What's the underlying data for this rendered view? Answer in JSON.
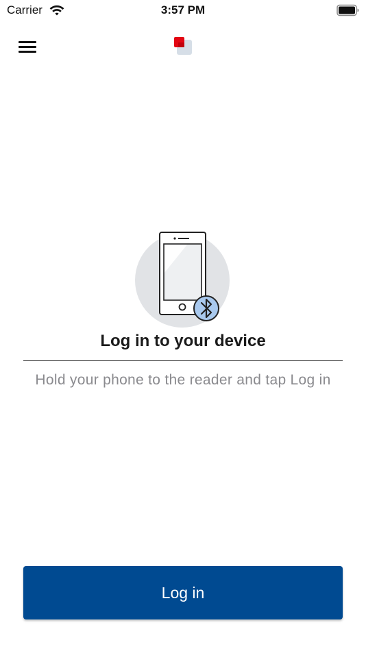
{
  "status_bar": {
    "carrier": "Carrier",
    "time": "3:57 PM",
    "wifi_icon": "wifi-icon",
    "battery_icon": "battery-icon"
  },
  "nav": {
    "menu_icon": "hamburger-menu-icon",
    "logo_icon": "app-logo-icon"
  },
  "main": {
    "illustration_icon": "phone-bluetooth-icon",
    "title": "Log in to your device",
    "instructions": "Hold your phone to the reader and tap Log in"
  },
  "actions": {
    "login_label": "Log in"
  },
  "colors": {
    "primary": "#004a91",
    "logo_red": "#e30613",
    "bluetooth_badge": "#a9c9ee",
    "muted_text": "#8a8a8e"
  }
}
